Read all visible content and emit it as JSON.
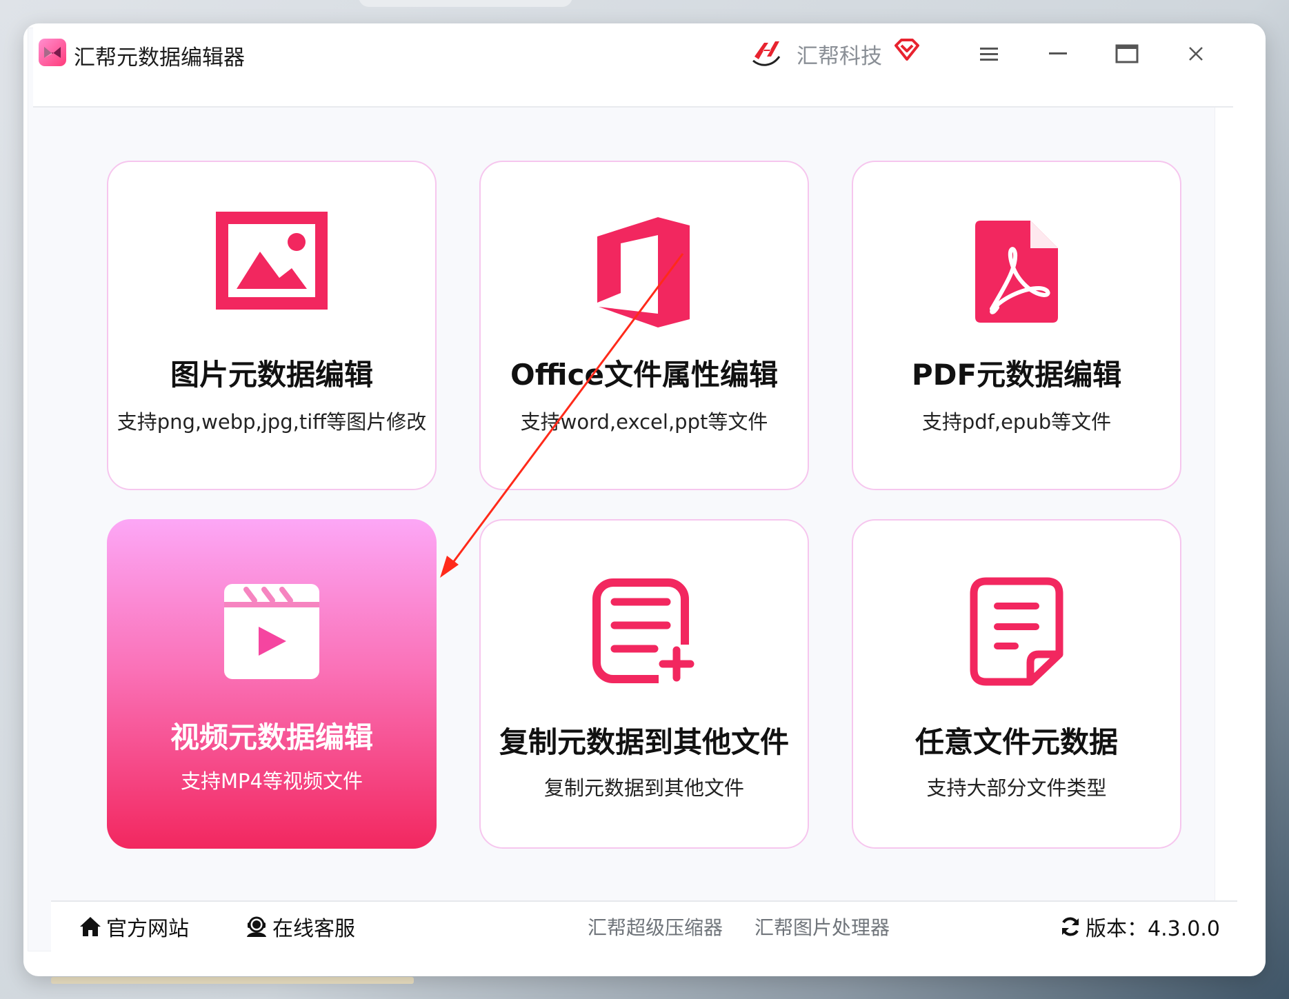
{
  "window": {
    "app_title": "汇帮元数据编辑器",
    "brand_name": "汇帮科技",
    "controls": {
      "menu_icon": "hamburger-menu-icon",
      "minimize_icon": "minimize-icon",
      "maximize_icon": "maximize-icon",
      "close_icon": "close-icon"
    }
  },
  "colors": {
    "accent": "#f2275f",
    "card_border": "#f6c6ee",
    "active_gradient_top": "#fca7f6",
    "active_gradient_bottom": "#f2275f",
    "annotation_arrow": "#ff2a1a"
  },
  "cards": [
    {
      "icon": "image-icon",
      "title": "图片元数据编辑",
      "desc": "支持png,webp,jpg,tiff等图片修改",
      "active": false
    },
    {
      "icon": "office-icon",
      "title": "Office文件属性编辑",
      "desc": "支持word,excel,ppt等文件",
      "active": false
    },
    {
      "icon": "pdf-icon",
      "title": "PDF元数据编辑",
      "desc": "支持pdf,epub等文件",
      "active": false
    },
    {
      "icon": "video-clapper-icon",
      "title": "视频元数据编辑",
      "desc": "支持MP4等视频文件",
      "active": true
    },
    {
      "icon": "document-add-icon",
      "title": "复制元数据到其他文件",
      "desc": "复制元数据到其他文件",
      "active": false
    },
    {
      "icon": "note-icon",
      "title": "任意文件元数据",
      "desc": "支持大部分文件类型",
      "active": false
    }
  ],
  "footer": {
    "official_site": "官方网站",
    "online_service": "在线客服",
    "link_compressor": "汇帮超级压缩器",
    "link_image_processor": "汇帮图片处理器",
    "version": "版本：4.3.0.0"
  }
}
